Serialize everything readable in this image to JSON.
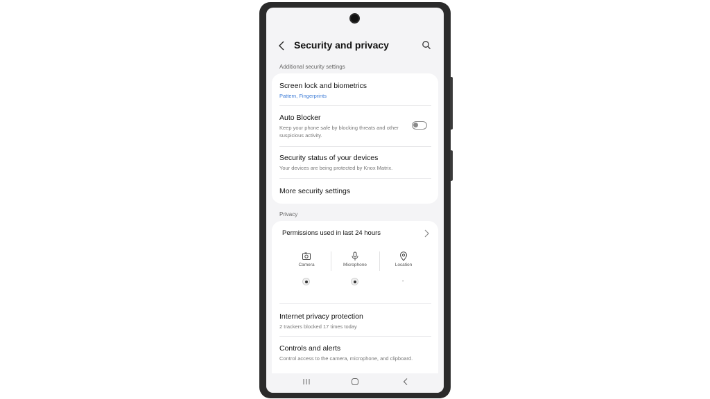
{
  "header": {
    "title": "Security and privacy",
    "back_icon": "chevron-left-icon",
    "search_icon": "search-icon"
  },
  "additional_security": {
    "label": "Additional security settings",
    "items": [
      {
        "title": "Screen lock and biometrics",
        "subtitle": "Pattern, Fingerprints"
      },
      {
        "title": "Auto Blocker",
        "subtitle": "Keep your phone safe by blocking threats and other suspicious activity.",
        "toggle": "off"
      },
      {
        "title": "Security status of your devices",
        "subtitle": "Your devices are being protected by Knox Matrix."
      },
      {
        "title": "More security settings"
      }
    ]
  },
  "privacy": {
    "label": "Privacy",
    "permissions_title": "Permissions used in last 24 hours",
    "permissions": [
      {
        "label": "Camera",
        "icon": "camera-icon",
        "status": "used"
      },
      {
        "label": "Microphone",
        "icon": "microphone-icon",
        "status": "used"
      },
      {
        "label": "Location",
        "icon": "location-icon",
        "status": "-"
      }
    ],
    "items": [
      {
        "title": "Internet privacy protection",
        "subtitle": "2 trackers blocked 17 times today"
      },
      {
        "title": "Controls and alerts",
        "subtitle": "Control access to the camera, microphone, and clipboard."
      }
    ]
  },
  "navbar": {
    "recents_icon": "recents-icon",
    "home_icon": "home-icon",
    "back_icon": "back-nav-icon"
  },
  "colors": {
    "accent_blue": "#3a7ad6",
    "screen_bg": "#f4f4f6",
    "card_bg": "#ffffff"
  }
}
